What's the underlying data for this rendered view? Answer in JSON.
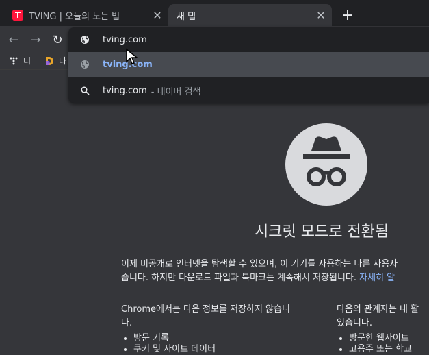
{
  "tabs": [
    {
      "title": "TVING | 오늘의 노는 법",
      "close": "✕"
    },
    {
      "title": "새 탭",
      "close": "✕"
    }
  ],
  "new_tab_label": "+",
  "toolbar": {
    "back": "←",
    "forward": "→",
    "reload": "↻"
  },
  "bookmarks": [
    {
      "label": "티",
      "icon": "grid-icon"
    },
    {
      "label": "다",
      "icon": "d-logo-icon"
    }
  ],
  "omnibox": {
    "input_value": "tving.com",
    "suggestions": [
      {
        "text": "tving.com",
        "icon": "globe-icon"
      },
      {
        "text": "tving.com",
        "suffix": "- 네이버 검색",
        "icon": "search-icon"
      }
    ]
  },
  "incognito": {
    "title": "시크릿 모드로 전환됨",
    "intro_line1": "이제 비공개로 인터넷을 탐색할 수 있으며, 이 기기를 사용하는 다른 사용자",
    "intro_line2": "습니다. 하지만 다운로드 파일과 북마크는 계속해서 저장됩니다.",
    "learn_more": "자세히 알",
    "left_heading_1": "Chrome에서는 다음 정보를 저장하지 않습니",
    "left_heading_2": "다.",
    "left_items": [
      "방문 기록",
      "쿠키 및 사이트 데이터"
    ],
    "right_heading_1": "다음의 관계자는 내 활",
    "right_heading_2": "있습니다.",
    "right_items": [
      "방문한 웹사이트",
      "고용주 또는 학교"
    ]
  }
}
